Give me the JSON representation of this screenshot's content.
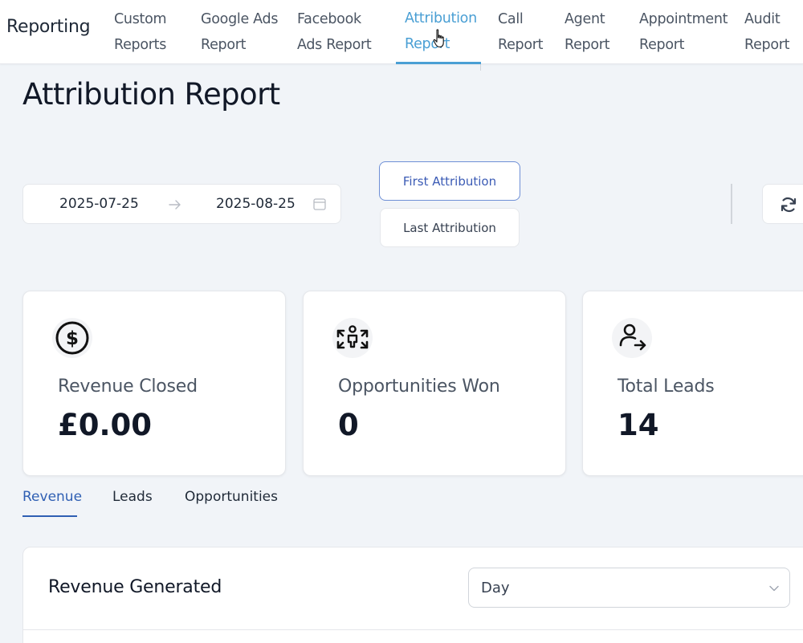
{
  "app": {
    "title": "Reporting"
  },
  "nav": {
    "items": [
      {
        "line1": "Custom",
        "line2": "Reports"
      },
      {
        "line1": "Google Ads",
        "line2": "Report"
      },
      {
        "line1": "Facebook",
        "line2": "Ads Report"
      },
      {
        "line1": "Attribution",
        "line2": "Report"
      },
      {
        "line1": "Call",
        "line2": "Report"
      },
      {
        "line1": "Agent",
        "line2": "Report"
      },
      {
        "line1": "Appointment",
        "line2": "Report"
      },
      {
        "line1": "Audit",
        "line2": "Report"
      }
    ],
    "active_index": 3
  },
  "page": {
    "title": "Attribution Report"
  },
  "filters": {
    "date_start": "2025-07-25",
    "date_end": "2025-08-25",
    "attribution_first": "First Attribution",
    "attribution_last": "Last Attribution",
    "selected_attribution": "First Attribution"
  },
  "cards": [
    {
      "label": "Revenue Closed",
      "value": "£0.00",
      "icon": "dollar-circle-icon"
    },
    {
      "label": "Opportunities Won",
      "value": "0",
      "icon": "arrows-expand-person-icon"
    },
    {
      "label": "Total Leads",
      "value": "14",
      "icon": "user-arrow-icon"
    }
  ],
  "tabs": {
    "items": [
      "Revenue",
      "Leads",
      "Opportunities"
    ],
    "active": "Revenue"
  },
  "panel": {
    "title": "Revenue Generated",
    "granularity": "Day"
  },
  "colors": {
    "accent_nav": "#4a9fd4",
    "accent_tab": "#2f5fb3",
    "background": "#f1f4f8"
  }
}
